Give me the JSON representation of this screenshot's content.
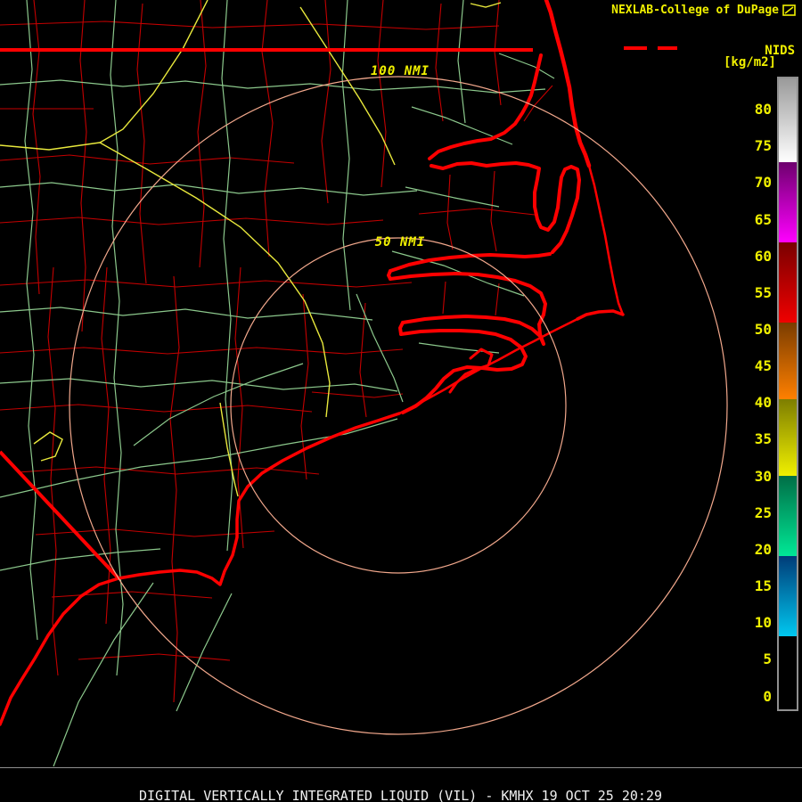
{
  "header": {
    "title": "NEXLAB-College of DuPage",
    "logo_icon": "college-of-dupage-logo"
  },
  "legend": {
    "title": "NIDS",
    "units": "[kg/m2]"
  },
  "scale": {
    "max_value": 84.5,
    "min_value": -2,
    "ticks": [
      80,
      75,
      70,
      65,
      60,
      55,
      50,
      45,
      40,
      35,
      30,
      25,
      20,
      15,
      10,
      5,
      0
    ],
    "segments": [
      {
        "from": 84.5,
        "to": 73,
        "top_color": "#9a9a9a",
        "bottom_color": "#ffffff"
      },
      {
        "from": 73,
        "to": 62,
        "top_color": "#6e006e",
        "bottom_color": "#ff00ff"
      },
      {
        "from": 62,
        "to": 51,
        "top_color": "#7a0000",
        "bottom_color": "#f00000"
      },
      {
        "from": 51,
        "to": 40.5,
        "top_color": "#7a3c00",
        "bottom_color": "#ff8000"
      },
      {
        "from": 40.5,
        "to": 30,
        "top_color": "#7e7e00",
        "bottom_color": "#f0f000"
      },
      {
        "from": 30,
        "to": 19,
        "top_color": "#006e46",
        "bottom_color": "#00e896"
      },
      {
        "from": 19,
        "to": 8,
        "top_color": "#003c78",
        "bottom_color": "#00c8f0"
      },
      {
        "from": 8,
        "to": -2,
        "top_color": "#000000",
        "bottom_color": "#000000"
      }
    ]
  },
  "rings": [
    {
      "label": "100 NMI"
    },
    {
      "label": "50 NMI"
    }
  ],
  "footer": {
    "caption": "DIGITAL VERTICALLY INTEGRATED LIQUID (VIL) - KMHX 19 OCT 25 20:29",
    "product": "DIGITAL VERTICALLY INTEGRATED LIQUID (VIL)",
    "station": "KMHX",
    "datetime": "19 OCT 25 20:29"
  },
  "colors": {
    "bg": "#000000",
    "coast": "#ff0000",
    "county": "#c40000",
    "road": "#8cc88c",
    "highway": "#e8e83c",
    "ring": "#f2a88c",
    "yellow": "#f0f000",
    "white": "#f0f0f0",
    "separator": "#8f8f8f"
  }
}
